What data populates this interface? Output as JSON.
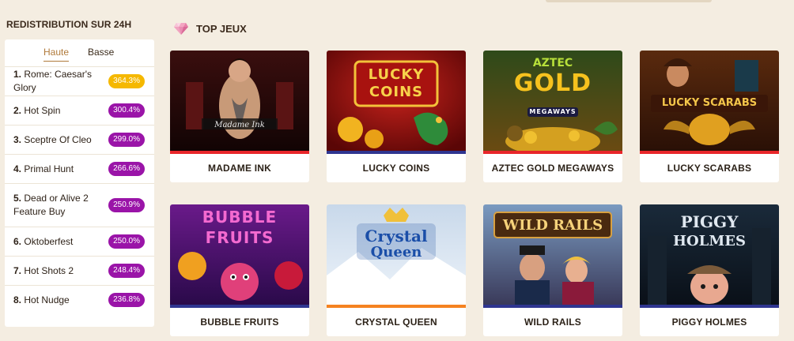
{
  "sidebar": {
    "title": "REDISTRIBUTION SUR 24H",
    "tabs": [
      {
        "label": "Haute",
        "active": true
      },
      {
        "label": "Basse",
        "active": false
      }
    ],
    "rankings": [
      {
        "rank": "1.",
        "name": "Rome: Caesar's Glory",
        "line1": "Rome: Caesar's",
        "line2": "Glory",
        "rtp": "364.3%",
        "color": "gold"
      },
      {
        "rank": "2.",
        "name": "Hot Spin",
        "line1": "Hot Spin",
        "line2": "",
        "rtp": "300.4%",
        "color": "purple"
      },
      {
        "rank": "3.",
        "name": "Sceptre Of Cleo",
        "line1": "Sceptre Of Cleo",
        "line2": "",
        "rtp": "299.0%",
        "color": "purple"
      },
      {
        "rank": "4.",
        "name": "Primal Hunt",
        "line1": "Primal Hunt",
        "line2": "",
        "rtp": "266.6%",
        "color": "purple"
      },
      {
        "rank": "5.",
        "name": "Dead or Alive 2 Feature Buy",
        "line1": "Dead or Alive 2",
        "line2": "Feature Buy",
        "rtp": "250.9%",
        "color": "purple"
      },
      {
        "rank": "6.",
        "name": "Oktoberfest",
        "line1": "Oktoberfest",
        "line2": "",
        "rtp": "250.0%",
        "color": "purple"
      },
      {
        "rank": "7.",
        "name": "Hot Shots 2",
        "line1": "Hot Shots 2",
        "line2": "",
        "rtp": "248.4%",
        "color": "purple"
      },
      {
        "rank": "8.",
        "name": "Hot Nudge",
        "line1": "Hot Nudge",
        "line2": "",
        "rtp": "236.8%",
        "color": "purple"
      }
    ]
  },
  "main": {
    "section_title": "TOP JEUX",
    "section_icon": "diamond-icon",
    "games": [
      {
        "label": "MADAME INK",
        "art_text": "Madame Ink",
        "stripe": "#e8262a"
      },
      {
        "label": "LUCKY COINS",
        "art_text": "LUCKY COINS",
        "stripe": "#2f3590"
      },
      {
        "label": "AZTEC GOLD MEGAWAYS",
        "art_text": "AZTEC GOLD",
        "art_sub": "MEGAWAYS",
        "stripe": "#e8262a"
      },
      {
        "label": "LUCKY SCARABS",
        "art_text": "LUCKY SCARABS",
        "stripe": "#e8262a"
      },
      {
        "label": "BUBBLE FRUITS",
        "art_text": "BUBBLE FRUITS",
        "stripe": "#2f3590"
      },
      {
        "label": "CRYSTAL QUEEN",
        "art_text": "Crystal Queen",
        "stripe": "#f58220"
      },
      {
        "label": "WILD RAILS",
        "art_text": "WILD RAILS",
        "stripe": "#2f3590"
      },
      {
        "label": "PIGGY HOLMES",
        "art_text": "PIGGY HOLMES",
        "stripe": "#2f3590"
      }
    ]
  },
  "colors": {
    "background": "#f4ede1",
    "accent": "#b07a3a",
    "badge_gold": "#f5b800",
    "badge_purple": "#9a14a8"
  }
}
